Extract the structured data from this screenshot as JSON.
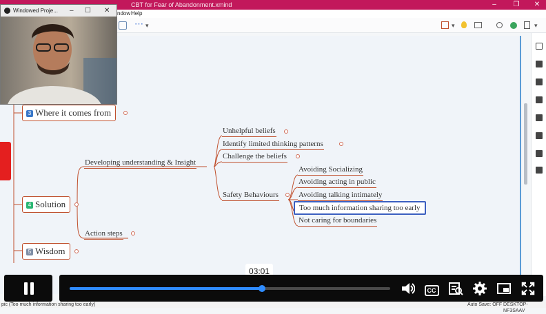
{
  "window": {
    "title": "CBT for Fear of Abandonment.xmind",
    "min": "–",
    "restore": "❐",
    "close": "✕"
  },
  "menu": {
    "visible_items": [
      "ndow",
      "Help"
    ]
  },
  "toolbar": {
    "more_icon": "more-icon",
    "dots": "⋯",
    "dropdown": "▾"
  },
  "webcam": {
    "title": "Windowed Proje...",
    "min": "–",
    "max": "☐",
    "close": "✕"
  },
  "mindmap": {
    "topics": [
      {
        "num": "3",
        "label": "Where it comes from",
        "num_color": "#3a78c9"
      },
      {
        "num": "4",
        "label": "Solution",
        "num_color": "#2bb673"
      },
      {
        "num": "5",
        "label": "Wisdom",
        "num_color": "#7f8fa6"
      }
    ],
    "solution_children": [
      "Developing understanding & Insight",
      "Action steps"
    ],
    "insight_children": [
      "Unhelpful beliefs",
      "Identify limited thinking patterns",
      "Challenge the beliefs",
      "Safety Behaviours"
    ],
    "safety_children": [
      "Avoiding Socializing",
      "Avoiding acting in public",
      "Avoiding talking intimately",
      "Too much information sharing too early",
      "Not caring for boundaries"
    ],
    "selected": "Too much information sharing too early",
    "branch_color": "#c0502e"
  },
  "player": {
    "time": "03:01",
    "progress": 0.6,
    "pause_icon": "pause-icon",
    "volume_icon": "volume-icon",
    "cc_label": "CC",
    "transcript_icon": "transcript-icon",
    "settings_icon": "gear-icon",
    "pip_icon": "picture-in-picture-icon",
    "fullscreen_icon": "fullscreen-icon",
    "accent": "#2f8cff"
  },
  "status": {
    "left": "pic (Too much information sharing too early)",
    "autosave": "Auto Save: OFF",
    "machine": "DESKTOP-NF3SAAV"
  }
}
